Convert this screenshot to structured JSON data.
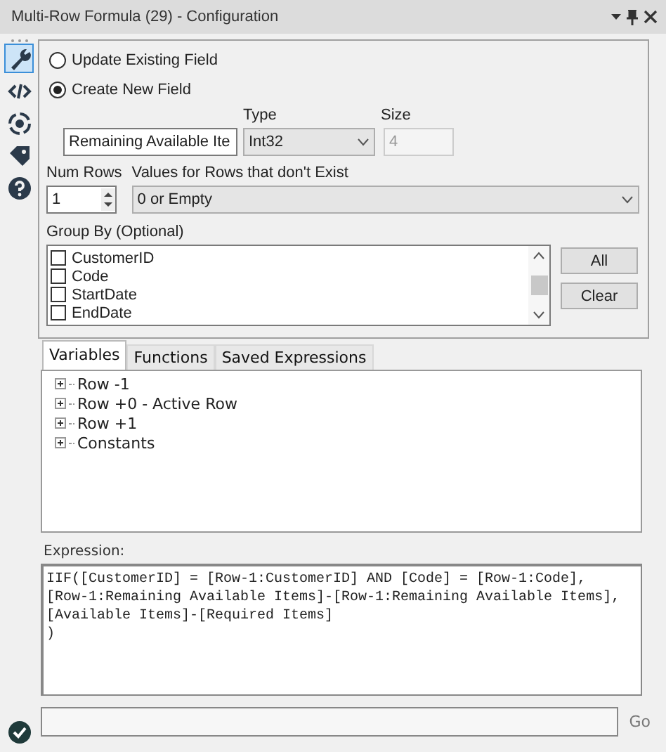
{
  "window": {
    "title": "Multi-Row Formula (29) - Configuration"
  },
  "sidebar": {
    "items": [
      {
        "kind": "wrench",
        "selected": true
      },
      {
        "kind": "code",
        "selected": false
      },
      {
        "kind": "target",
        "selected": false
      },
      {
        "kind": "tag",
        "selected": false
      },
      {
        "kind": "help",
        "selected": false
      }
    ]
  },
  "field_mode": [
    {
      "label": "Update Existing Field",
      "selected": false
    },
    {
      "label": "Create New  Field",
      "selected": true
    }
  ],
  "new_field": {
    "name": "Remaining Available Ite",
    "type_label": "Type",
    "type": "Int32",
    "size_label": "Size",
    "size": "4",
    "size_disabled": true
  },
  "num_rows": {
    "label": "Num Rows",
    "value": "1"
  },
  "missing_rows": {
    "label": "Values for Rows that don't Exist",
    "value": "0 or Empty"
  },
  "group_by": {
    "label": "Group By (Optional)",
    "items": [
      {
        "label": "CustomerID",
        "checked": false
      },
      {
        "label": "Code",
        "checked": false
      },
      {
        "label": "StartDate",
        "checked": false
      },
      {
        "label": "EndDate",
        "checked": false
      }
    ],
    "buttons": [
      "All",
      "Clear"
    ]
  },
  "tabs": [
    {
      "label": "Variables",
      "selected": true
    },
    {
      "label": "Functions",
      "selected": false
    },
    {
      "label": "Saved Expressions",
      "selected": false
    }
  ],
  "tree": [
    {
      "label": "Row -1",
      "expanded": false
    },
    {
      "label": "Row +0 - Active Row",
      "expanded": false
    },
    {
      "label": "Row +1",
      "expanded": false
    },
    {
      "label": "Constants",
      "expanded": false
    }
  ],
  "expression": {
    "label": "Expression:",
    "lines": [
      "IIF([CustomerID] = [Row-1:CustomerID] AND [Code] = [Row-1:Code],",
      "[Row-1:Remaining Available Items]-[Row-1:Remaining Available Items],",
      "[Available Items]-[Required Items]",
      ")"
    ]
  },
  "go": {
    "label": "Go"
  },
  "status": {
    "ok": true
  }
}
